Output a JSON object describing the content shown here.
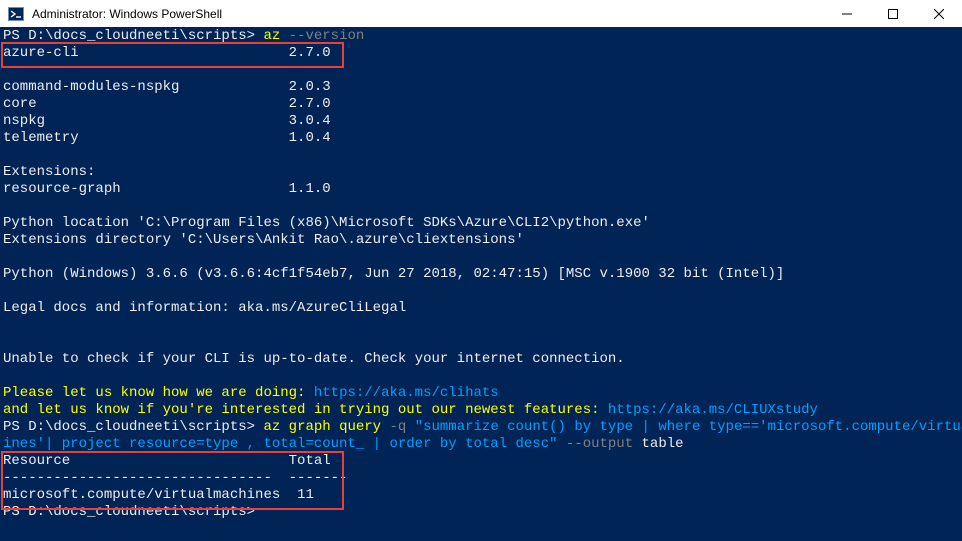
{
  "window": {
    "title": "Administrator: Windows PowerShell",
    "icon": "powershell-icon",
    "controls": [
      "minimize-icon",
      "maximize-icon",
      "close-icon"
    ]
  },
  "colors": {
    "console_bg": "#012456",
    "text": "#eeedf0",
    "command": "#ffff00",
    "string": "#00a0ff",
    "parameter": "#808080",
    "highlight": "#e8403c"
  },
  "console": {
    "l1_prompt": "PS D:\\docs_cloudneeti\\scripts> ",
    "l1_cmd": "az",
    "l1_param": " --version",
    "l2": "azure-cli                         2.7.0",
    "l4": "command-modules-nspkg             2.0.3",
    "l5": "core                              2.7.0",
    "l6": "nspkg                             3.0.4",
    "l7": "telemetry                         1.0.4",
    "l9": "Extensions:",
    "l10": "resource-graph                    1.1.0",
    "l12": "Python location 'C:\\Program Files (x86)\\Microsoft SDKs\\Azure\\CLI2\\python.exe'",
    "l13": "Extensions directory 'C:\\Users\\Ankit Rao\\.azure\\cliextensions'",
    "l15": "Python (Windows) 3.6.6 (v3.6.6:4cf1f54eb7, Jun 27 2018, 02:47:15) [MSC v.1900 32 bit (Intel)]",
    "l17": "Legal docs and information: aka.ms/AzureCliLegal",
    "l20": "Unable to check if your CLI is up-to-date. Check your internet connection.",
    "l22_text": "Please let us know how we are doing: ",
    "l22_link": "https://aka.ms/clihats",
    "l23_text": "and let us know if you're interested in trying out our newest features: ",
    "l23_link": "https://aka.ms/CLIUXstudy",
    "l24_prompt": "PS D:\\docs_cloudneeti\\scripts> ",
    "l24_cmd": "az",
    "l24_args": " graph query ",
    "l24_param": "-q ",
    "l24_string": "\"summarize count() by type | where type=='microsoft.compute/virtualmach",
    "l25_string": "ines'| project resource=type , total=count_ | order by total desc\"",
    "l25_param": " --output ",
    "l25_value": "table",
    "l26": "Resource                          Total",
    "l27": "--------------------------------  -------",
    "l28": "microsoft.compute/virtualmachines  11",
    "l29": "PS D:\\docs_cloudneeti\\scripts> "
  }
}
